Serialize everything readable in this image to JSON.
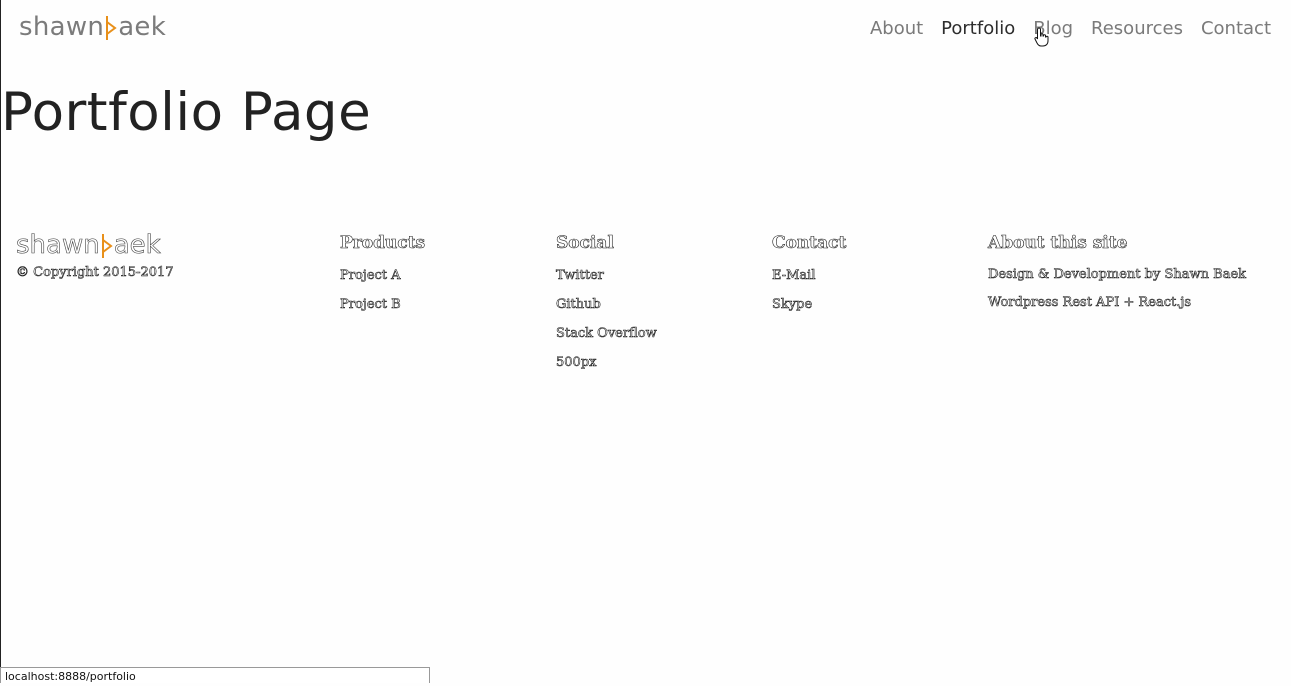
{
  "header": {
    "logo_left": "shawn",
    "logo_right": "aek",
    "nav": [
      {
        "label": "About"
      },
      {
        "label": "Portfolio"
      },
      {
        "label": "Blog"
      },
      {
        "label": "Resources"
      },
      {
        "label": "Contact"
      }
    ],
    "active_nav": "Portfolio"
  },
  "main": {
    "title": "Portfolio Page"
  },
  "footer": {
    "logo_left": "shawn",
    "logo_right": "aek",
    "copyright": "© Copyright 2015-2017",
    "products": {
      "heading": "Products",
      "items": [
        "Project A",
        "Project B"
      ]
    },
    "social": {
      "heading": "Social",
      "items": [
        "Twitter",
        "Github",
        "Stack Overflow",
        "500px"
      ]
    },
    "contact": {
      "heading": "Contact",
      "items": [
        "E-Mail",
        "Skype"
      ]
    },
    "about": {
      "heading": "About this site",
      "items": [
        "Design & Development by Shawn Baek",
        "Wordpress Rest API + React.js"
      ]
    }
  },
  "status_bar": {
    "url": "localhost:8888/portfolio"
  },
  "colors": {
    "logo_accent": "#e8901a",
    "nav_text": "#7a7a7a",
    "nav_active": "#2d2d2d"
  },
  "icons": {
    "logo_mark": "b-play-mark-icon",
    "cursor": "hand-pointer-icon"
  }
}
